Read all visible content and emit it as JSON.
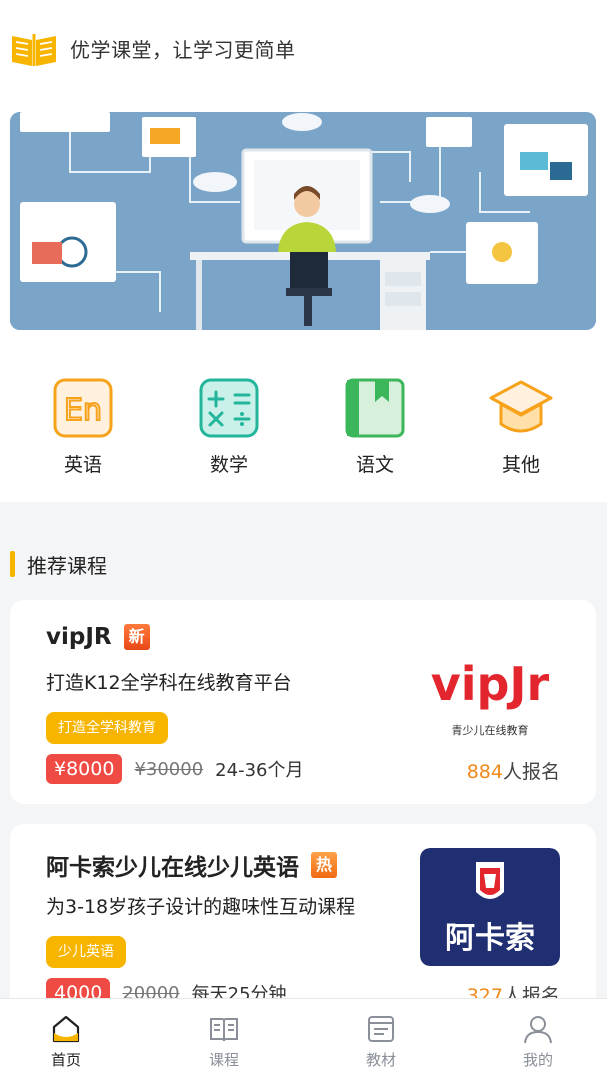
{
  "header": {
    "slogan": "优学课堂，让学习更简单"
  },
  "colors": {
    "accent": "#f7b500",
    "price": "#f04a44",
    "count": "#f08a1c",
    "banner_bg": "#7aa5c8"
  },
  "categories": [
    {
      "label": "英语",
      "icon": "english-en-icon"
    },
    {
      "label": "数学",
      "icon": "math-symbols-icon"
    },
    {
      "label": "语文",
      "icon": "chinese-book-icon"
    },
    {
      "label": "其他",
      "icon": "graduation-cap-icon"
    }
  ],
  "section": {
    "title": "推荐课程"
  },
  "courses": [
    {
      "name": "vipJR",
      "badge": "新",
      "desc": "打造K12全学科在线教育平台",
      "tag": "打造全学科教育",
      "price": "¥8000",
      "original_price": "¥30000",
      "duration": "24-36个月",
      "enroll_count": "884",
      "enroll_suffix": "人报名",
      "logo_text": "vipJr",
      "logo_sub": "青少儿在线教育"
    },
    {
      "name": "阿卡索少儿在线少儿英语",
      "badge": "热",
      "desc": "为3-18岁孩子设计的趣味性互动课程",
      "tag": "少儿英语",
      "price": "4000",
      "original_price": "20000",
      "duration": "每天25分钟",
      "enroll_count": "327",
      "enroll_suffix": "人报名",
      "logo_text": "阿卡索"
    }
  ],
  "tabs": [
    {
      "label": "首页",
      "icon": "home-icon",
      "active": true
    },
    {
      "label": "课程",
      "icon": "book-open-icon"
    },
    {
      "label": "教材",
      "icon": "textbook-icon"
    },
    {
      "label": "我的",
      "icon": "user-icon"
    }
  ]
}
